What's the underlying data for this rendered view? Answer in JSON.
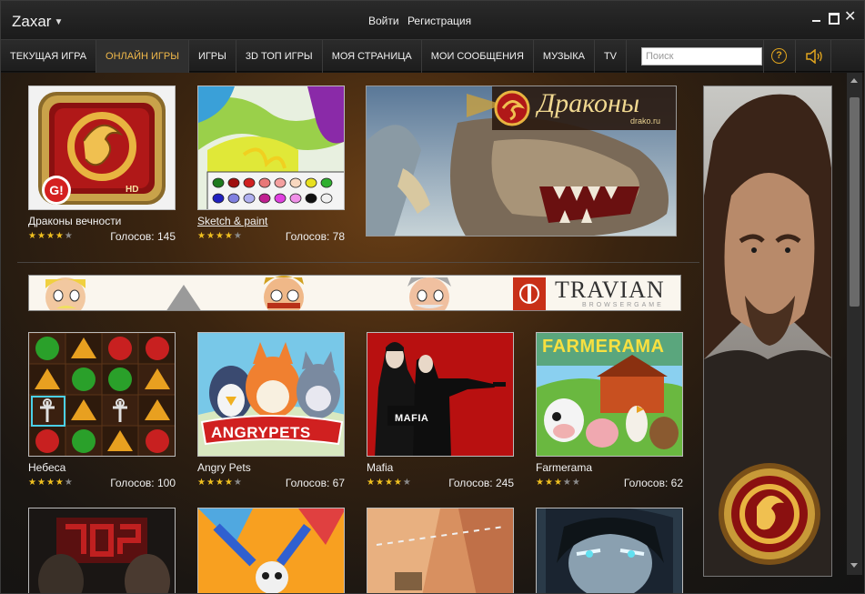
{
  "app": {
    "title": "Zaxar"
  },
  "auth": {
    "login": "Войти",
    "register": "Регистрация"
  },
  "nav": {
    "items": [
      {
        "label": "ТЕКУЩАЯ ИГРА"
      },
      {
        "label": "ОНЛАЙН ИГРЫ",
        "active": true
      },
      {
        "label": "ИГРЫ"
      },
      {
        "label": "3D ТОП ИГРЫ"
      },
      {
        "label": "МОЯ СТРАНИЦА"
      },
      {
        "label": "МОИ СООБЩЕНИЯ"
      },
      {
        "label": "МУЗЫКА"
      },
      {
        "label": "TV"
      }
    ],
    "search_placeholder": "Поиск",
    "help_glyph": "?",
    "icons": [
      "help-icon",
      "sound-icon"
    ]
  },
  "banners": {
    "dragons_title": "Драконы",
    "dragons_site": "drako.ru",
    "travian_title": "TRAVIAN",
    "travian_sub": "BROWSERGAME"
  },
  "tiles": {
    "row1": [
      {
        "name": "Драконы вечности",
        "votes": "Голосов: 145",
        "rating": 4,
        "badge": "HD"
      },
      {
        "name": "Sketch & paint",
        "votes": "Голосов: 78",
        "rating": 4
      }
    ],
    "row2": [
      {
        "name": "Небеса",
        "votes": "Голосов: 100",
        "rating": 4
      },
      {
        "name": "Angry Pets",
        "votes": "Голосов: 67",
        "rating": 4,
        "logo": "ANGRYPETS"
      },
      {
        "name": "Mafia",
        "votes": "Голосов: 245",
        "rating": 4,
        "logo": "MAFIA"
      },
      {
        "name": "Farmerama",
        "votes": "Голосов: 62",
        "rating": 3,
        "logo": "FARMERAMA"
      }
    ]
  },
  "colors": {
    "accent": "#f0b84a",
    "star": "#f0c020",
    "help": "#e0a41e"
  }
}
